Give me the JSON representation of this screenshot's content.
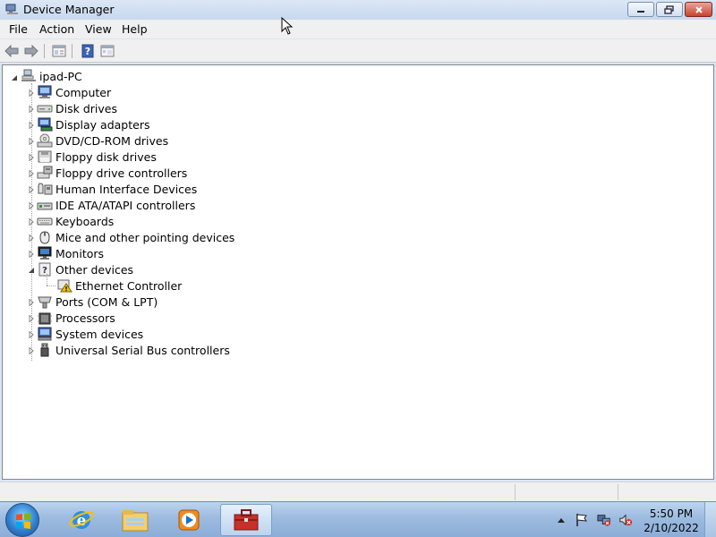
{
  "window": {
    "title": "Device Manager"
  },
  "menu": {
    "items": [
      "File",
      "Action",
      "View",
      "Help"
    ]
  },
  "toolbar": {
    "buttons": [
      "back-arrow-icon",
      "forward-arrow-icon",
      "properties-icon",
      "help-icon",
      "device-view-icon"
    ]
  },
  "tree": {
    "root": {
      "label": "ipad-PC",
      "icon": "computer-network-icon",
      "expanded": true
    },
    "categories": [
      {
        "label": "Computer",
        "icon": "computer-icon",
        "expanded": false
      },
      {
        "label": "Disk drives",
        "icon": "disk-drive-icon",
        "expanded": false
      },
      {
        "label": "Display adapters",
        "icon": "display-adapter-icon",
        "expanded": false
      },
      {
        "label": "DVD/CD-ROM drives",
        "icon": "dvd-drive-icon",
        "expanded": false
      },
      {
        "label": "Floppy disk drives",
        "icon": "floppy-disk-icon",
        "expanded": false
      },
      {
        "label": "Floppy drive controllers",
        "icon": "floppy-controller-icon",
        "expanded": false
      },
      {
        "label": "Human Interface Devices",
        "icon": "hid-icon",
        "expanded": false
      },
      {
        "label": "IDE ATA/ATAPI controllers",
        "icon": "ide-controller-icon",
        "expanded": false
      },
      {
        "label": "Keyboards",
        "icon": "keyboard-icon",
        "expanded": false
      },
      {
        "label": "Mice and other pointing devices",
        "icon": "mouse-icon",
        "expanded": false
      },
      {
        "label": "Monitors",
        "icon": "monitor-icon",
        "expanded": false
      },
      {
        "label": "Other devices",
        "icon": "unknown-device-icon",
        "expanded": true,
        "children": [
          {
            "label": "Ethernet Controller",
            "icon": "warning-device-icon"
          }
        ]
      },
      {
        "label": "Ports (COM & LPT)",
        "icon": "port-icon",
        "expanded": false
      },
      {
        "label": "Processors",
        "icon": "processor-icon",
        "expanded": false
      },
      {
        "label": "System devices",
        "icon": "system-device-icon",
        "expanded": false
      },
      {
        "label": "Universal Serial Bus controllers",
        "icon": "usb-icon",
        "expanded": false
      }
    ]
  },
  "taskbar": {
    "apps": [
      "internet-explorer-icon",
      "windows-explorer-icon",
      "media-player-icon",
      "device-manager-taskbar-icon"
    ],
    "tray": [
      "show-hidden-icons-icon",
      "action-center-flag-icon",
      "network-icon",
      "volume-muted-icon"
    ],
    "clock": {
      "time": "5:50 PM",
      "date": "2/10/2022"
    }
  },
  "colors": {
    "titlebar": "#c7d8ee",
    "taskbar": "#9dbbe0",
    "warning": "#f2c200",
    "close": "#c8442d"
  }
}
